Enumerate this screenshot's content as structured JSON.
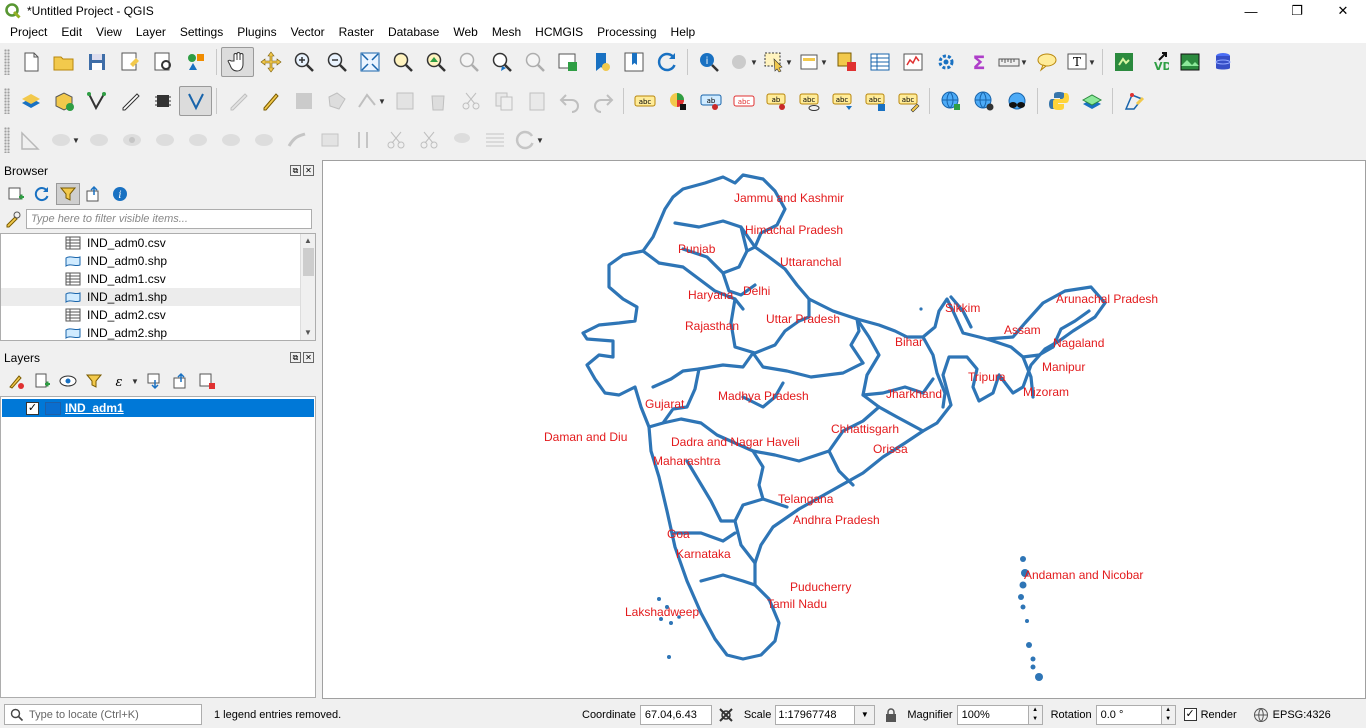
{
  "window": {
    "title": "*Untitled Project - QGIS",
    "minimize": "—",
    "maximize": "❐",
    "close": "✕"
  },
  "menu": [
    "Project",
    "Edit",
    "View",
    "Layer",
    "Settings",
    "Plugins",
    "Vector",
    "Raster",
    "Database",
    "Web",
    "Mesh",
    "HCMGIS",
    "Processing",
    "Help"
  ],
  "browser": {
    "title": "Browser",
    "filter_placeholder": "Type here to filter visible items...",
    "items": [
      {
        "name": "IND_adm0.csv",
        "kind": "table",
        "selected": false
      },
      {
        "name": "IND_adm0.shp",
        "kind": "polygon",
        "selected": false
      },
      {
        "name": "IND_adm1.csv",
        "kind": "table",
        "selected": false
      },
      {
        "name": "IND_adm1.shp",
        "kind": "polygon",
        "selected": true
      },
      {
        "name": "IND_adm2.csv",
        "kind": "table",
        "selected": false
      },
      {
        "name": "IND_adm2.shp",
        "kind": "polygon",
        "selected": false
      }
    ]
  },
  "layers": {
    "title": "Layers",
    "items": [
      {
        "name": "IND_adm1",
        "checked": true,
        "check_mark": "✓"
      }
    ]
  },
  "map": {
    "outline_color": "#2e75b6",
    "label_color": "#e31a1c",
    "labels": [
      "Jammu and Kashmir",
      "Himachal Pradesh",
      "Punjab",
      "Uttaranchal",
      "Haryana",
      "Delhi",
      "Sikkim",
      "Arunachal Pradesh",
      "Rajasthan",
      "Uttar Pradesh",
      "Assam",
      "Bihar",
      "Nagaland",
      "Manipur",
      "Tripura",
      "Mizoram",
      "Jharkhand",
      "Madhya Pradesh",
      "Gujarat",
      "Daman and Diu",
      "Chhattisgarh",
      "Dadra and Nagar Haveli",
      "Orissa",
      "Maharashtra",
      "Telangana",
      "Andhra Pradesh",
      "Goa",
      "Karnataka",
      "Puducherry",
      "Tamil Nadu",
      "Lakshadweep",
      "Andaman and Nicobar"
    ]
  },
  "status": {
    "locator_placeholder": "Type to locate (Ctrl+K)",
    "message": "1 legend entries removed.",
    "coordinate_label": "Coordinate",
    "coordinate_value": "67.04,6.43",
    "scale_label": "Scale",
    "scale_value": "1:17967748",
    "magnifier_label": "Magnifier",
    "magnifier_value": "100%",
    "rotation_label": "Rotation",
    "rotation_value": "0.0 °",
    "render_label": "Render",
    "render_checked": true,
    "crs": "EPSG:4326"
  }
}
